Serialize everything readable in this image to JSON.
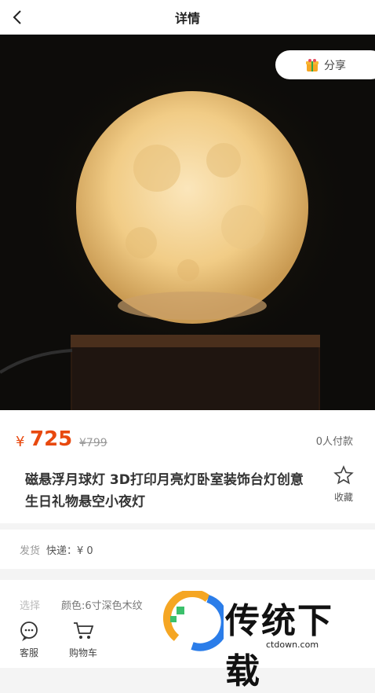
{
  "header": {
    "title": "详情"
  },
  "share": {
    "label": "分享"
  },
  "product": {
    "currency": "¥",
    "price": "725",
    "original_price": "¥799",
    "paid_count": "0人付款",
    "title": "磁悬浮月球灯 3D打印月亮灯卧室装饰台灯创意生日礼物悬空小夜灯",
    "favorite_label": "收藏"
  },
  "shipping": {
    "label": "发货",
    "value": "快递：¥ 0"
  },
  "select": {
    "label": "选择",
    "value": "颜色:6寸深色木纹"
  },
  "tabs": {
    "service_label": "客服",
    "cart_label": "购物车"
  },
  "watermark": {
    "text": "传统下载",
    "url": "ctdown.com"
  },
  "colors": {
    "accent": "#e8490f",
    "hero_bg": "#0d0c0a"
  }
}
